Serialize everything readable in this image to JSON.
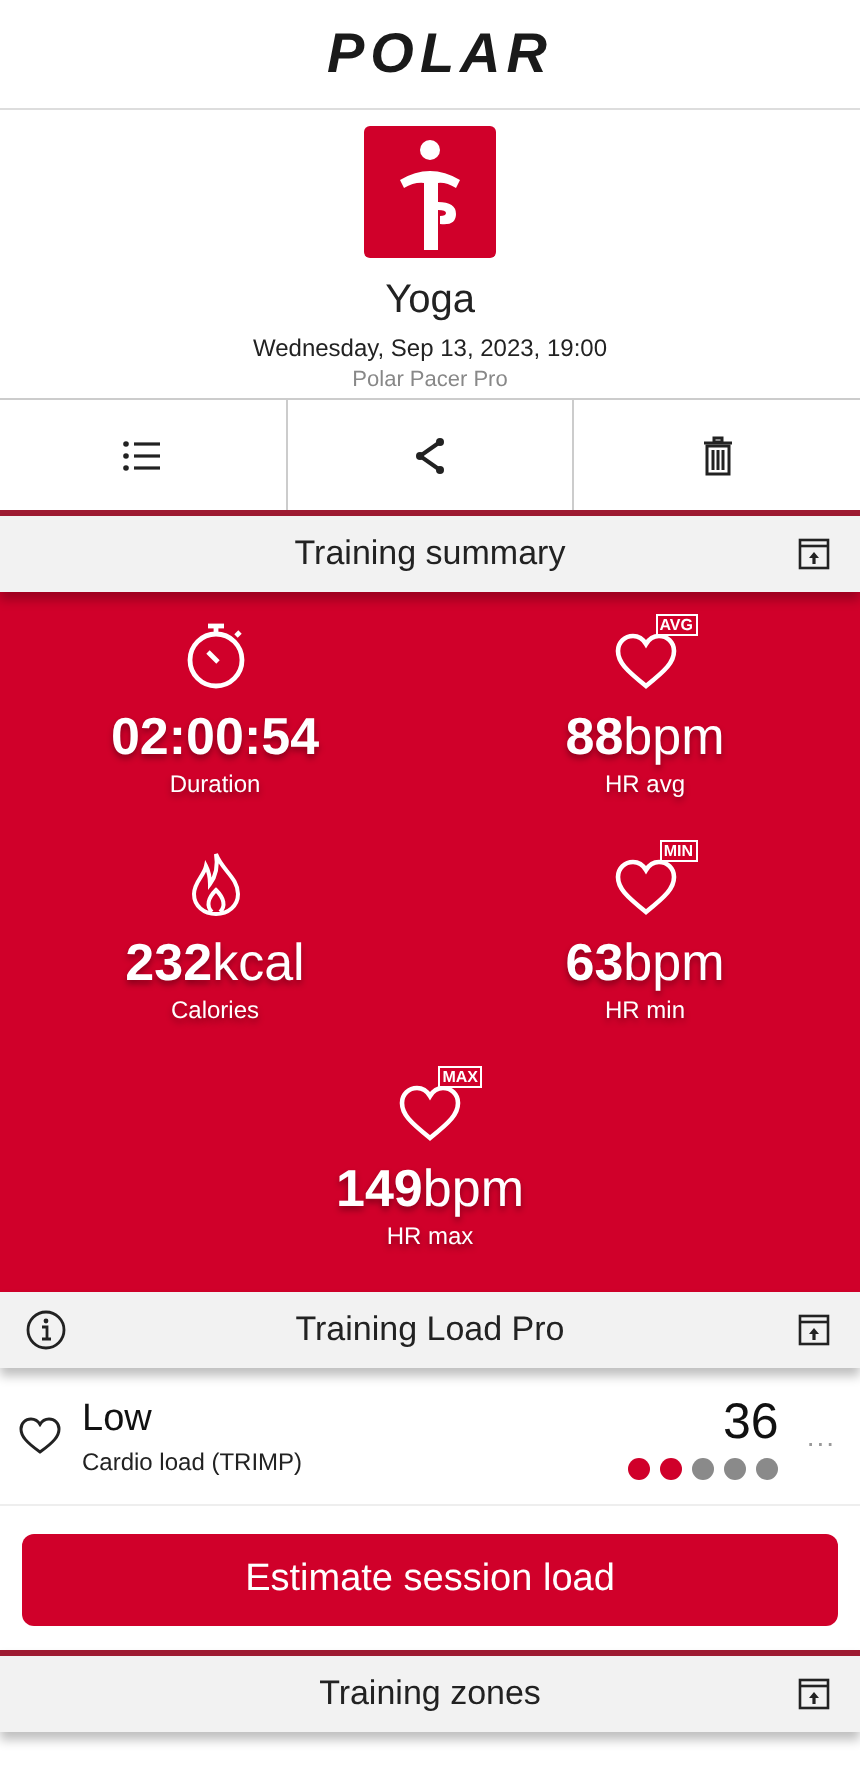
{
  "header": {
    "brand": "POLAR"
  },
  "activity": {
    "sport": "Yoga",
    "datetime": "Wednesday, Sep 13, 2023, 19:00",
    "device": "Polar Pacer Pro"
  },
  "actions": [
    {
      "kind": "list"
    },
    {
      "kind": "share"
    },
    {
      "kind": "delete"
    }
  ],
  "training_summary": {
    "title": "Training summary",
    "stats": [
      {
        "kind": "stopwatch",
        "value": "02:00:54",
        "label": "Duration"
      },
      {
        "kind": "heart",
        "badge": "AVG",
        "value": "88",
        "unit": "bpm",
        "label": "HR avg"
      },
      {
        "kind": "flame",
        "value": "232",
        "unit": "kcal",
        "label": "Calories"
      },
      {
        "kind": "heart",
        "badge": "MIN",
        "value": "63",
        "unit": "bpm",
        "label": "HR min"
      },
      {
        "kind": "heart",
        "badge": "MAX",
        "value": "149",
        "unit": "bpm",
        "label": "HR max"
      }
    ]
  },
  "training_load": {
    "title": "Training Load Pro",
    "level": "Low",
    "caption": "Cardio load (TRIMP)",
    "value": "36",
    "dots": [
      {
        "on": true
      },
      {
        "on": true
      },
      {
        "on": false
      },
      {
        "on": false
      },
      {
        "on": false
      }
    ],
    "more": "...",
    "button": "Estimate session load"
  },
  "training_zones": {
    "title": "Training zones"
  }
}
